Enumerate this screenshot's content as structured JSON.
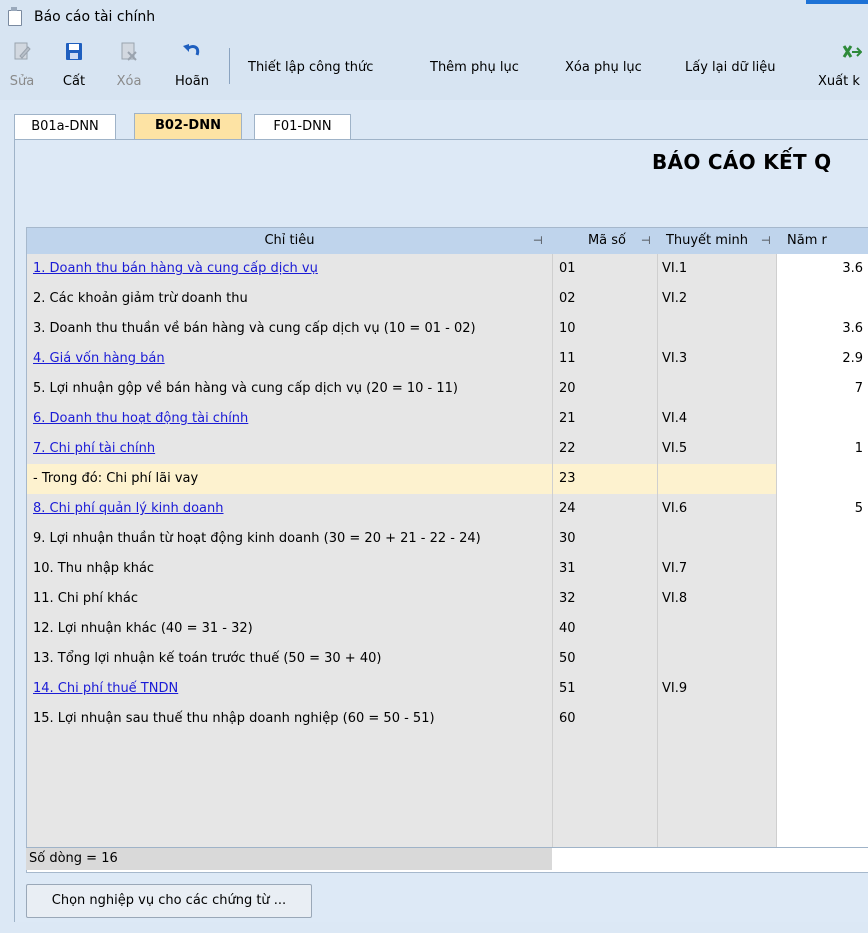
{
  "window": {
    "title": "Báo cáo tài chính"
  },
  "toolbar": {
    "edit_label": "Sửa",
    "save_label": "Cất",
    "delete_label": "Xóa",
    "undo_label": "Hoãn",
    "setup_formula_label": "Thiết lập công thức",
    "add_appendix_label": "Thêm phụ lục",
    "delete_appendix_label": "Xóa phụ lục",
    "refresh_data_label": "Lấy lại dữ liệu",
    "export_label": "Xuất k"
  },
  "tabs": [
    "B01a-DNN",
    "B02-DNN",
    "F01-DNN"
  ],
  "active_tab": "B02-DNN",
  "report": {
    "title": "BÁO CÁO KẾT Q"
  },
  "grid": {
    "headers": {
      "indicator": "Chỉ tiêu",
      "code": "Mã số",
      "note": "Thuyết minh",
      "year": "Năm r"
    },
    "rows": [
      {
        "indicator": "1. Doanh thu bán hàng và cung cấp dịch vụ",
        "code": "01",
        "note": "VI.1",
        "value": "3.6",
        "link": true
      },
      {
        "indicator": "2. Các khoản giảm trừ doanh thu",
        "code": "02",
        "note": "VI.2",
        "value": "",
        "link": false
      },
      {
        "indicator": "3. Doanh thu thuần về bán hàng và cung cấp dịch vụ (10 = 01 - 02)",
        "code": "10",
        "note": "",
        "value": "3.6",
        "link": false
      },
      {
        "indicator": "4. Giá vốn hàng bán",
        "code": "11",
        "note": "VI.3",
        "value": "2.9",
        "link": true
      },
      {
        "indicator": "5. Lợi nhuận gộp về bán hàng và cung cấp dịch vụ (20 = 10 - 11)",
        "code": "20",
        "note": "",
        "value": "7",
        "link": false
      },
      {
        "indicator": "6. Doanh thu hoạt động tài chính",
        "code": "21",
        "note": "VI.4",
        "value": "",
        "link": true
      },
      {
        "indicator": "7. Chi phí tài chính",
        "code": "22",
        "note": "VI.5",
        "value": "1",
        "link": true
      },
      {
        "indicator": "- Trong đó: Chi phí lãi vay",
        "code": "23",
        "note": "",
        "value": "",
        "link": false
      },
      {
        "indicator": "8. Chi phí quản lý kinh doanh",
        "code": "24",
        "note": "VI.6",
        "value": "5",
        "link": true
      },
      {
        "indicator": "9. Lợi nhuận thuần từ hoạt động kinh doanh (30 = 20 + 21 - 22 - 24)",
        "code": "30",
        "note": "",
        "value": "",
        "link": false
      },
      {
        "indicator": "10. Thu nhập khác",
        "code": "31",
        "note": "VI.7",
        "value": "",
        "link": false
      },
      {
        "indicator": "11. Chi phí khác",
        "code": "32",
        "note": "VI.8",
        "value": "",
        "link": false
      },
      {
        "indicator": "12. Lợi nhuận khác (40 = 31 - 32)",
        "code": "40",
        "note": "",
        "value": "",
        "link": false
      },
      {
        "indicator": "13. Tổng lợi nhuận kế toán trước thuế (50 = 30 + 40)",
        "code": "50",
        "note": "",
        "value": "",
        "link": false
      },
      {
        "indicator": "14. Chi phí thuế TNDN",
        "code": "51",
        "note": "VI.9",
        "value": "",
        "link": true
      },
      {
        "indicator": "15. Lợi nhuận sau thuế thu nhập doanh nghiệp (60 = 50 - 51)",
        "code": "60",
        "note": "",
        "value": "",
        "link": false
      }
    ],
    "selected_row": 7,
    "empty_rows": 4,
    "row_count_label": "Số dòng = 16"
  },
  "bottom_button": "Chọn nghiệp vụ cho các chứng từ ...",
  "colors": {
    "link": "#1b1bd6",
    "selected_row": "#fdf2cf",
    "active_tab": "#fde3a4",
    "header": "#bfd4ec"
  }
}
